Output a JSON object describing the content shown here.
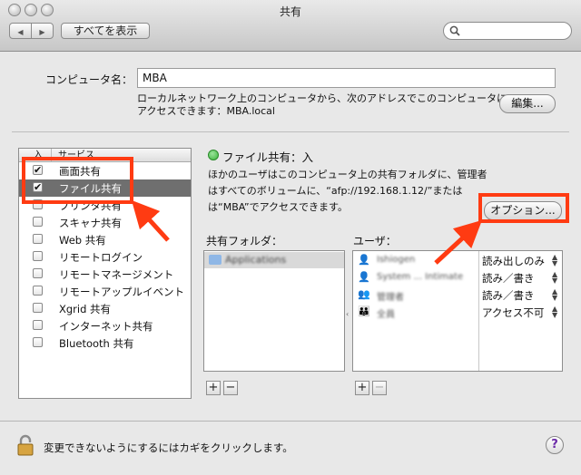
{
  "window": {
    "title": "共有"
  },
  "toolbar": {
    "back": "◀",
    "forward": "▶",
    "show_all": "すべてを表示",
    "search_placeholder": ""
  },
  "computer_name": {
    "label": "コンピュータ名：",
    "value": "MBA",
    "description_line1": "ローカルネットワーク上のコンピュータから、次のアドレスでこのコンピュータに",
    "description_line2": "アクセスできます：MBA.local",
    "edit_button": "編集..."
  },
  "services": {
    "header_on": "入",
    "header_service": "サービス",
    "items": [
      {
        "label": "画面共有",
        "checked": "✔"
      },
      {
        "label": "ファイル共有",
        "checked": "✔"
      },
      {
        "label": "プリンタ共有",
        "checked": ""
      },
      {
        "label": "スキャナ共有",
        "checked": ""
      },
      {
        "label": "Web 共有",
        "checked": ""
      },
      {
        "label": "リモートログイン",
        "checked": ""
      },
      {
        "label": "リモートマネージメント",
        "checked": ""
      },
      {
        "label": "リモートアップルイベント",
        "checked": ""
      },
      {
        "label": "Xgrid 共有",
        "checked": ""
      },
      {
        "label": "インターネット共有",
        "checked": ""
      },
      {
        "label": "Bluetooth 共有",
        "checked": ""
      }
    ],
    "selected": "ファイル共有"
  },
  "status": {
    "title": "ファイル共有：入",
    "desc_line1": "ほかのユーザはこのコンピュータ上の共有フォルダに、管理者",
    "desc_line2": "はすべてのボリュームに、“afp://192.168.1.12/”または",
    "desc_line3": "は“MBA”でアクセスできます。",
    "options_button": "オプション..."
  },
  "shared_folders": {
    "label": "共有フォルダ：",
    "items": [
      "Applications"
    ],
    "add": "+",
    "remove": "−"
  },
  "users": {
    "label": "ユーザ：",
    "items": [
      {
        "name": "Ishiogen",
        "perm": "読み出しのみ",
        "icon": "single-user-icon"
      },
      {
        "name": "System ... Intimate",
        "perm": "読み／書き",
        "icon": "single-user-icon"
      },
      {
        "name": "管理者",
        "perm": "読み／書き",
        "icon": "group-icon"
      },
      {
        "name": "全員",
        "perm": "アクセス不可",
        "icon": "everyone-icon"
      }
    ],
    "add": "+",
    "remove": "−"
  },
  "footer": {
    "lock_text": "変更できないようにするにはカギをクリックします。",
    "help": "?"
  },
  "colors": {
    "annotation": "#ff3b12",
    "status_green": "#3cb53c",
    "selection": "#6f6f6f"
  }
}
